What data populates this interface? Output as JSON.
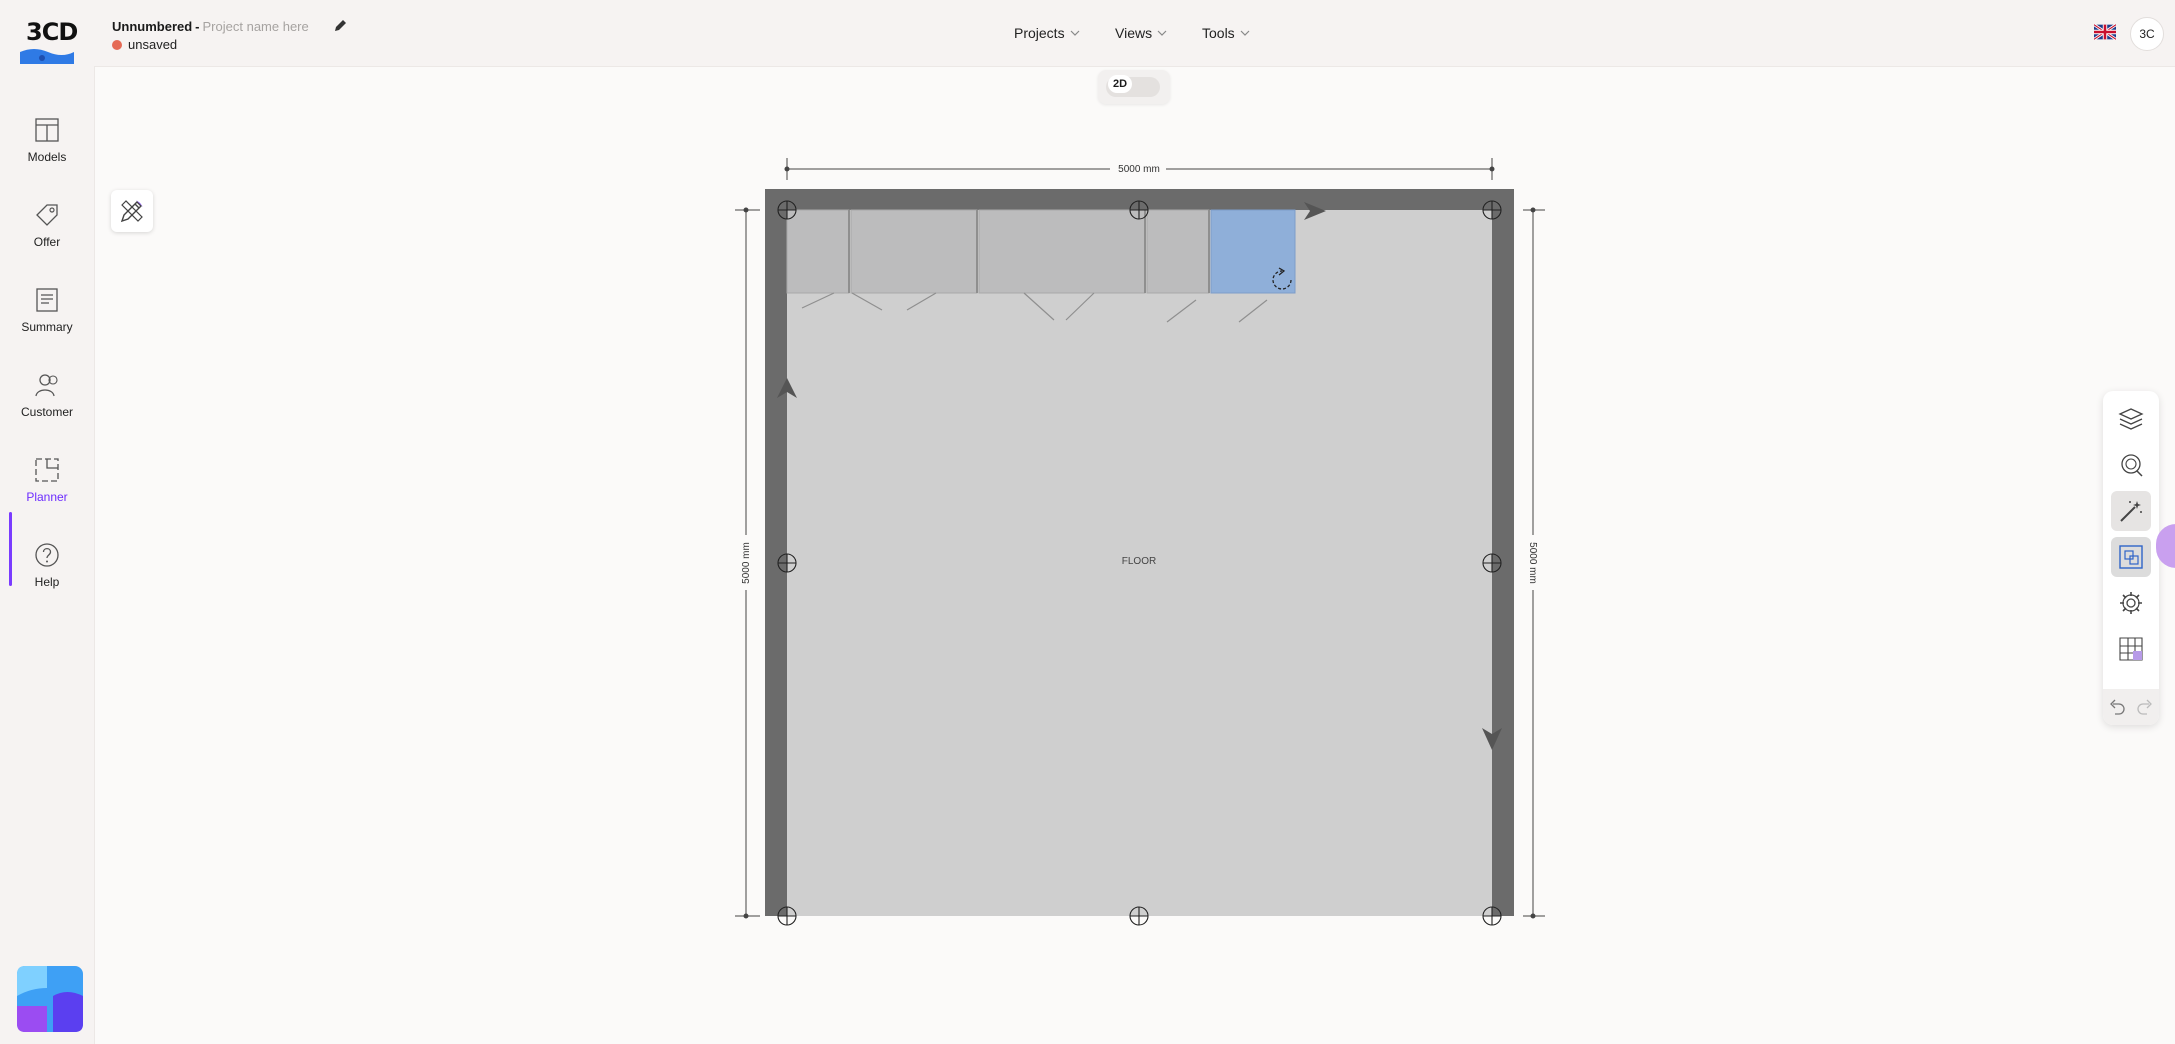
{
  "app": {
    "logo_text": "3CD"
  },
  "project": {
    "name": "Unnumbered",
    "separator": "-",
    "placeholder": "Project name here",
    "status": "unsaved"
  },
  "nav": [
    {
      "label": "Projects"
    },
    {
      "label": "Views"
    },
    {
      "label": "Tools"
    }
  ],
  "user": {
    "initials": "3C",
    "language_flag": "uk-flag-icon"
  },
  "sidebar": {
    "items": [
      {
        "label": "Models",
        "icon": "models-icon"
      },
      {
        "label": "Offer",
        "icon": "tag-icon"
      },
      {
        "label": "Summary",
        "icon": "summary-icon"
      },
      {
        "label": "Customer",
        "icon": "customer-icon"
      },
      {
        "label": "Planner",
        "icon": "planner-icon",
        "active": true
      },
      {
        "label": "Help",
        "icon": "help-icon"
      }
    ]
  },
  "view_toggle": {
    "label": "2D"
  },
  "plan": {
    "width_dim": "5000 mm",
    "left_dim": "5000 mm",
    "right_dim": "5000 mm",
    "floor_label": "FLOOR"
  },
  "right_toolbar": {
    "tools": [
      "layers-icon",
      "search-zoom-icon",
      "magic-wand-icon",
      "select-area-icon",
      "settings-icon",
      "room-grid-icon"
    ],
    "undo": "undo-icon",
    "redo": "redo-icon"
  },
  "colors": {
    "accent": "#7a3bff",
    "status_dot": "#e56a55",
    "wall": "#6a6a6a",
    "floor": "#cfcfcf",
    "selected_cabinet": "#8fafd9"
  }
}
